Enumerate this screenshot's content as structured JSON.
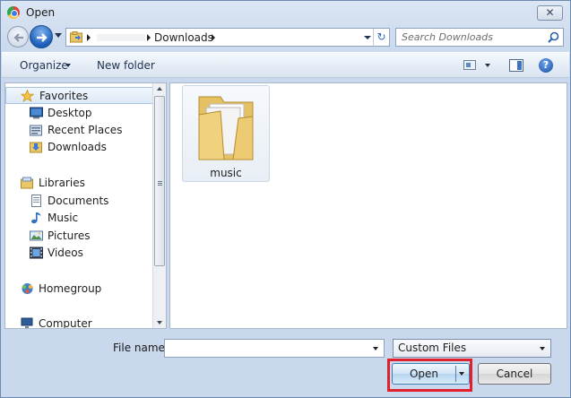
{
  "window": {
    "title": "Open",
    "close_symbol": "✕"
  },
  "nav": {
    "address": {
      "segments": [
        "Downloads"
      ],
      "refresh_symbol": "↻"
    },
    "search": {
      "placeholder": "Search Downloads"
    }
  },
  "toolbar": {
    "organize_label": "Organize",
    "new_folder_label": "New folder",
    "help_symbol": "?"
  },
  "sidebar": {
    "sections": [
      {
        "label": "Favorites",
        "icon": "star-icon",
        "items": [
          {
            "label": "Desktop",
            "icon": "desktop-icon"
          },
          {
            "label": "Recent Places",
            "icon": "recent-places-icon"
          },
          {
            "label": "Downloads",
            "icon": "downloads-folder-icon"
          }
        ]
      },
      {
        "label": "Libraries",
        "icon": "libraries-icon",
        "items": [
          {
            "label": "Documents",
            "icon": "documents-icon"
          },
          {
            "label": "Music",
            "icon": "music-note-icon"
          },
          {
            "label": "Pictures",
            "icon": "pictures-icon"
          },
          {
            "label": "Videos",
            "icon": "videos-icon"
          }
        ]
      },
      {
        "label": "Homegroup",
        "icon": "homegroup-icon",
        "items": []
      },
      {
        "label": "Computer",
        "icon": "computer-icon",
        "items": []
      }
    ]
  },
  "files": [
    {
      "name": "music",
      "type": "folder",
      "icon": "folder-icon"
    }
  ],
  "footer": {
    "file_name_label": "File name:",
    "file_name_value": "",
    "file_type": "Custom Files",
    "open_label": "Open",
    "cancel_label": "Cancel",
    "highlight_color": "#e0212b"
  }
}
